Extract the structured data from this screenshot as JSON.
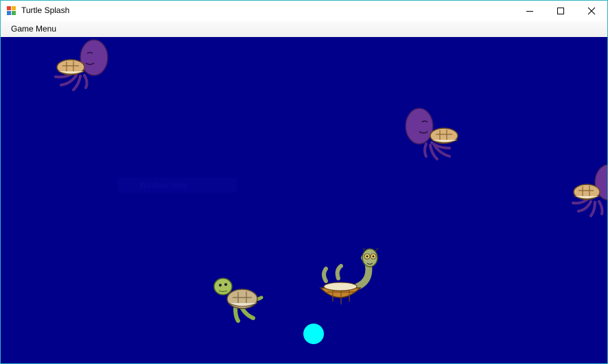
{
  "window": {
    "title": "Turtle Splash",
    "border_color": "#2bb5c2",
    "icon": "app-icon",
    "controls": [
      "minimize-icon",
      "maximize-icon",
      "close-icon"
    ]
  },
  "menu": {
    "items": [
      {
        "label": "Game Menu"
      }
    ]
  },
  "game": {
    "background_color": "#00008b",
    "ghost_menu_text": "Window Step",
    "ball_color": "#00ffff",
    "sprites": [
      {
        "name": "purple-octopus-turtle-sprite",
        "facing": "left"
      },
      {
        "name": "purple-octopus-turtle-sprite",
        "facing": "right"
      },
      {
        "name": "purple-octopus-turtle-sprite",
        "facing": "left"
      },
      {
        "name": "green-turtle-sprite"
      },
      {
        "name": "flipped-turtle-sprite"
      }
    ]
  }
}
